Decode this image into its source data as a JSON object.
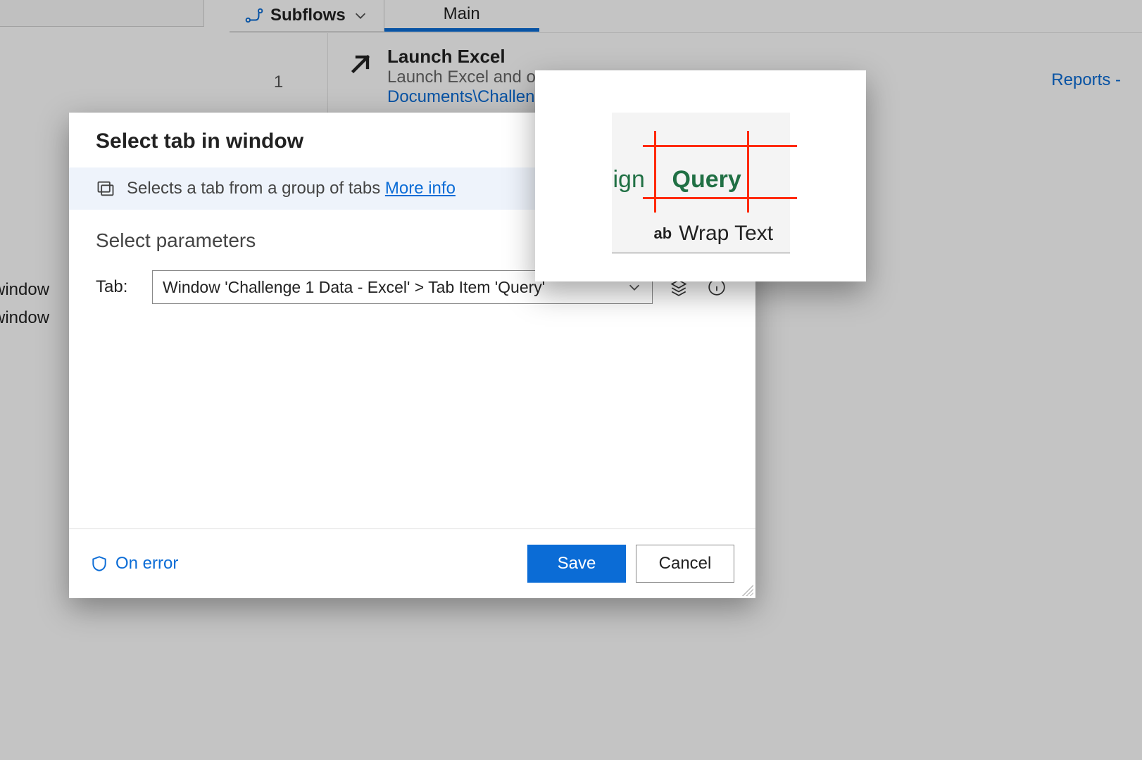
{
  "tabs": {
    "subflows_label": "Subflows",
    "main_label": "Main"
  },
  "flow": {
    "step_number": "1",
    "step_title": "Launch Excel",
    "step_desc": "Launch Excel and op",
    "step_path": "Documents\\Challenc",
    "reports_link": "Reports -"
  },
  "side": {
    "item1": "window",
    "item2": "window"
  },
  "dialog": {
    "title": "Select tab in window",
    "info_text": "Selects a tab from a group of tabs ",
    "more_info": "More info",
    "params_heading": "Select parameters",
    "tab_label": "Tab:",
    "tab_value": "Window 'Challenge 1 Data - Excel' > Tab Item 'Query'",
    "on_error": "On error",
    "save": "Save",
    "cancel": "Cancel"
  },
  "preview": {
    "partial_tab": "ign",
    "tab_name": "Query",
    "wrap_text": "Wrap Text"
  }
}
